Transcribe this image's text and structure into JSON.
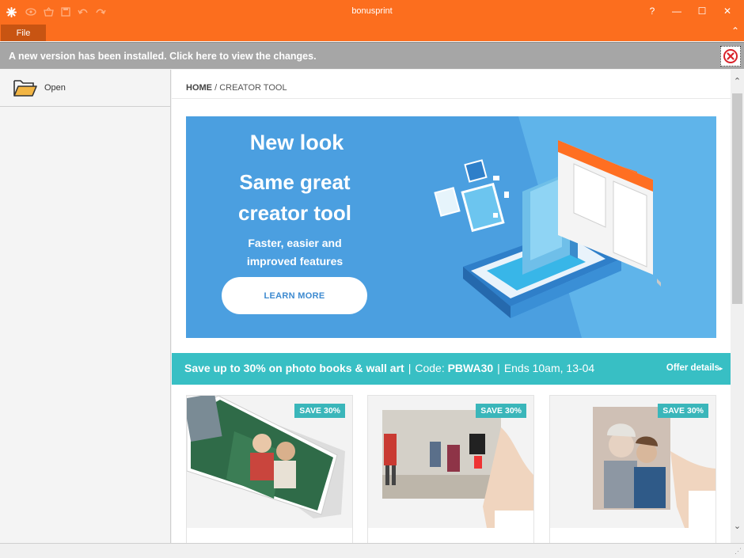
{
  "window": {
    "title": "bonusprint",
    "help_label": "?",
    "minimize_label": "—",
    "maximize_label": "☐",
    "close_label": "✕"
  },
  "menu": {
    "file_label": "File",
    "collapse_label": "⌃"
  },
  "notice": {
    "text": "A new version has been installed. Click here to view the changes."
  },
  "sidebar": {
    "open_label": "Open"
  },
  "breadcrumb": {
    "home": "HOME",
    "separator": "/",
    "current": "CREATOR TOOL"
  },
  "hero": {
    "headline": "New look",
    "subheadline_line1": "Same great",
    "subheadline_line2": "creator tool",
    "body_line1": "Faster, easier and",
    "body_line2": "improved features",
    "button_label": "LEARN MORE"
  },
  "promo": {
    "offer": "Save up to 30% on photo books & wall art",
    "separator": "|",
    "code_prefix": "Code:",
    "code": "PBWA30",
    "ends": "Ends 10am, 13-04",
    "details_label": "Offer details"
  },
  "cards": [
    {
      "badge": "SAVE 30%"
    },
    {
      "badge": "SAVE 30%"
    },
    {
      "badge": "SAVE 30%"
    }
  ],
  "colors": {
    "brand_orange": "#fc6e1e",
    "hero_blue": "#4b9fe0",
    "promo_teal": "#38bfc4",
    "badge_teal": "#3ab6ba"
  }
}
